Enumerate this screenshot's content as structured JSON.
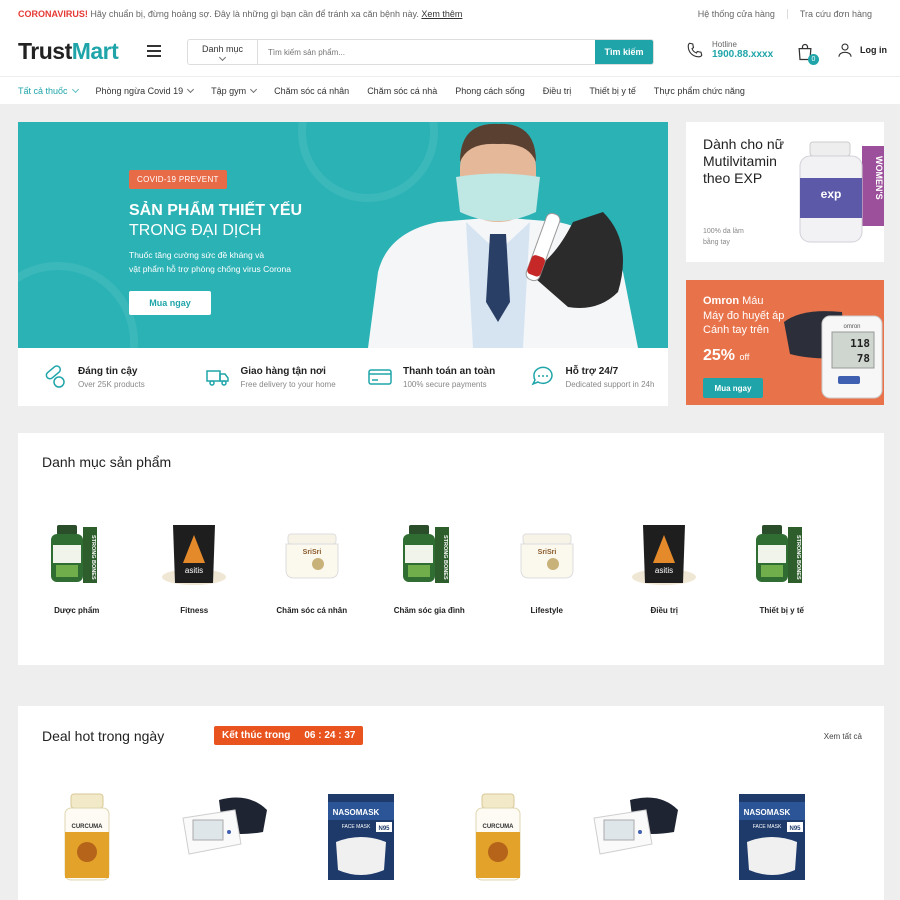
{
  "topbar": {
    "alert_label": "CORONAVIRUS!",
    "alert_text": "Hãy chuẩn bị, đừng hoảng sợ. Đây là những gì bạn cần để tránh xa căn bệnh này.",
    "alert_link": "Xem thêm",
    "links": [
      "Hệ thống cửa hàng",
      "Tra cứu đơn hàng"
    ]
  },
  "header": {
    "logo_part1": "Trust",
    "logo_part2": "Mart",
    "search_category": "Danh mục",
    "search_placeholder": "Tìm kiếm sản phẩm...",
    "search_button": "Tìm kiếm",
    "hotline_label": "Hotline",
    "hotline_number": "1900.88.xxxx",
    "cart_count": "0",
    "login_label": "Log in"
  },
  "nav": {
    "items": [
      {
        "label": "Tất cả thuốc",
        "dropdown": true,
        "active": true
      },
      {
        "label": "Phòng ngừa Covid 19",
        "dropdown": true
      },
      {
        "label": "Tập gym",
        "dropdown": true
      },
      {
        "label": "Chăm sóc cá nhân"
      },
      {
        "label": "Chăm sóc cá nhà"
      },
      {
        "label": "Phong cách sống"
      },
      {
        "label": "Điều trị"
      },
      {
        "label": "Thiết bị y tế"
      },
      {
        "label": "Thực phẩm chức năng"
      }
    ]
  },
  "hero": {
    "badge": "COVID-19 PREVENT",
    "title_line1": "SẢN PHẨM THIẾT YẾU",
    "title_line2": "TRONG ĐẠI DỊCH",
    "desc_line1": "Thuốc tăng cường sức đề kháng và",
    "desc_line2": "vật phẩm hỗ trợ phòng chống virus Corona",
    "cta": "Mua ngay"
  },
  "features": [
    {
      "title": "Đáng tin cậy",
      "sub": "Over 25K products",
      "icon": "pill-icon"
    },
    {
      "title": "Giao hàng tận nơi",
      "sub": "Free delivery to your home",
      "icon": "truck-icon"
    },
    {
      "title": "Thanh toán an toàn",
      "sub": "100% secure payments",
      "icon": "card-icon"
    },
    {
      "title": "Hỗ trợ 24/7",
      "sub": "Dedicated support in 24h",
      "icon": "chat-icon"
    }
  ],
  "side_banner1": {
    "title": "Dành cho nữ Mutilvitamin theo EXP",
    "sub": "100% da làm bằng tay",
    "product_brand": "exp",
    "product_tag": "WOMEN'S"
  },
  "side_banner2": {
    "brand": "Omron",
    "brand_rest": "Máu",
    "line": "Máy đo huyết áp Cánh tay trên",
    "percent": "25%",
    "off": "off",
    "cta": "Mua ngay",
    "device_readout1": "118",
    "device_readout2": "78",
    "device_brand": "omron"
  },
  "categories": {
    "title": "Danh mục sản phẩm",
    "items": [
      {
        "label": "Dược phẩm",
        "img": "bottle"
      },
      {
        "label": "Fitness",
        "img": "bag"
      },
      {
        "label": "Chăm sóc cá nhân",
        "img": "jar"
      },
      {
        "label": "Chăm sóc gia đình",
        "img": "bottle"
      },
      {
        "label": "Lifestyle",
        "img": "jar"
      },
      {
        "label": "Điều trị",
        "img": "bag"
      },
      {
        "label": "Thiết bị y tế",
        "img": "bottle"
      }
    ],
    "bottle_tag": "STRONG BONES",
    "jar_brand": "SriSri",
    "bag_brand": "asitis"
  },
  "deals": {
    "title": "Deal hot trong ngày",
    "timer_label": "Kết thúc trong",
    "timer_value": "06 : 24 : 37",
    "see_all": "Xem tất cả",
    "items": [
      "curcuma",
      "bp-monitor",
      "mask",
      "curcuma",
      "bp-monitor",
      "mask"
    ],
    "curcuma_label": "CURCUMA",
    "mask_brand": "NASOMASK",
    "mask_tag": "N95",
    "mask_label": "FACE MASK"
  },
  "colors": {
    "accent": "#1fa5a9",
    "orange": "#e8734a",
    "alert_red": "#e53935",
    "timer": "#e8531e"
  }
}
